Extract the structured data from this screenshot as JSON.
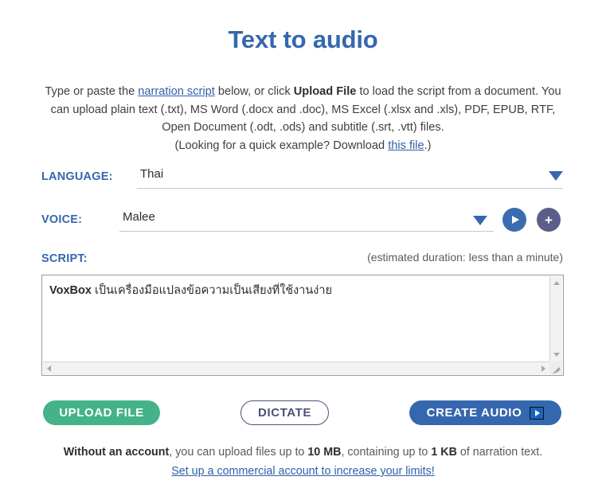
{
  "page": {
    "title": "Text to audio"
  },
  "intro": {
    "line1_a": "Type or paste the ",
    "link_narration": "narration script",
    "line1_b": " below, or click ",
    "bold_upload": "Upload File",
    "line1_c": " to load the script from a document. You can upload plain text (.txt), MS Word (.docx and .doc), MS Excel (.xlsx and .xls), PDF, EPUB, RTF, Open Document (.odt, .ods) and subtitle (.srt, .vtt) files.",
    "line2_a": "(Looking for a quick example? Download ",
    "link_thisfile": "this file",
    "line2_b": ".)"
  },
  "language": {
    "label": "LANGUAGE:",
    "value": "Thai",
    "caret_icon": "chevron-down-icon"
  },
  "voice": {
    "label": "VOICE:",
    "value": "Malee",
    "caret_icon": "chevron-down-icon",
    "preview_icon": "play-icon",
    "add_icon": "plus-icon"
  },
  "script": {
    "label": "SCRIPT:",
    "duration": "(estimated duration: less than a minute)",
    "brand": "VoxBox",
    "text": " เป็นเครื่องมือแปลงข้อความเป็นเสียงที่ใช้งานง่าย"
  },
  "actions": {
    "upload_label": "UPLOAD FILE",
    "dictate_label": "DICTATE",
    "create_label": "CREATE AUDIO",
    "create_icon": "play-icon"
  },
  "footer": {
    "bold_prefix": "Without an account",
    "text_a": ", you can upload files up to ",
    "limit_size": "10 MB",
    "text_b": ", containing up to ",
    "limit_text": "1 KB",
    "text_c": " of narration text.",
    "link": "Set up a commercial account to increase your limits!"
  },
  "colors": {
    "accent_blue": "#3567ae",
    "green": "#44b38a",
    "purple_gray": "#4d4f77",
    "link_blue": "#2f5fa8"
  }
}
